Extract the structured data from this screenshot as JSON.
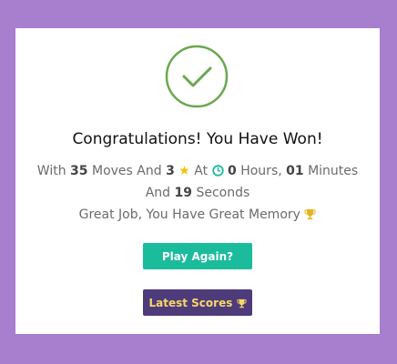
{
  "modal": {
    "title": "Congratulations! You Have Won!",
    "stats": {
      "prefix": "With",
      "moves": "35",
      "moves_label": "Moves And",
      "stars": "3",
      "at_label": "At",
      "hours": "0",
      "hours_label": "Hours,",
      "minutes": "01",
      "minutes_label": "Minutes",
      "and_label": "And",
      "seconds": "19",
      "seconds_label": "Seconds"
    },
    "message": "Great Job, You Have Great Memory",
    "play_again_label": "Play Again?",
    "latest_scores_label": "Latest Scores"
  },
  "colors": {
    "background": "#a87ecf",
    "success_green": "#6aa84f",
    "play_button": "#1abc9c",
    "scores_button": "#4e3b7a",
    "scores_text": "#f5d86a",
    "star": "#f4c20d",
    "clock": "#1abc9c",
    "trophy": "#e6b422"
  },
  "icons": {
    "success": "check-circle-icon",
    "star": "star-icon",
    "clock": "clock-icon",
    "trophy": "trophy-icon"
  }
}
